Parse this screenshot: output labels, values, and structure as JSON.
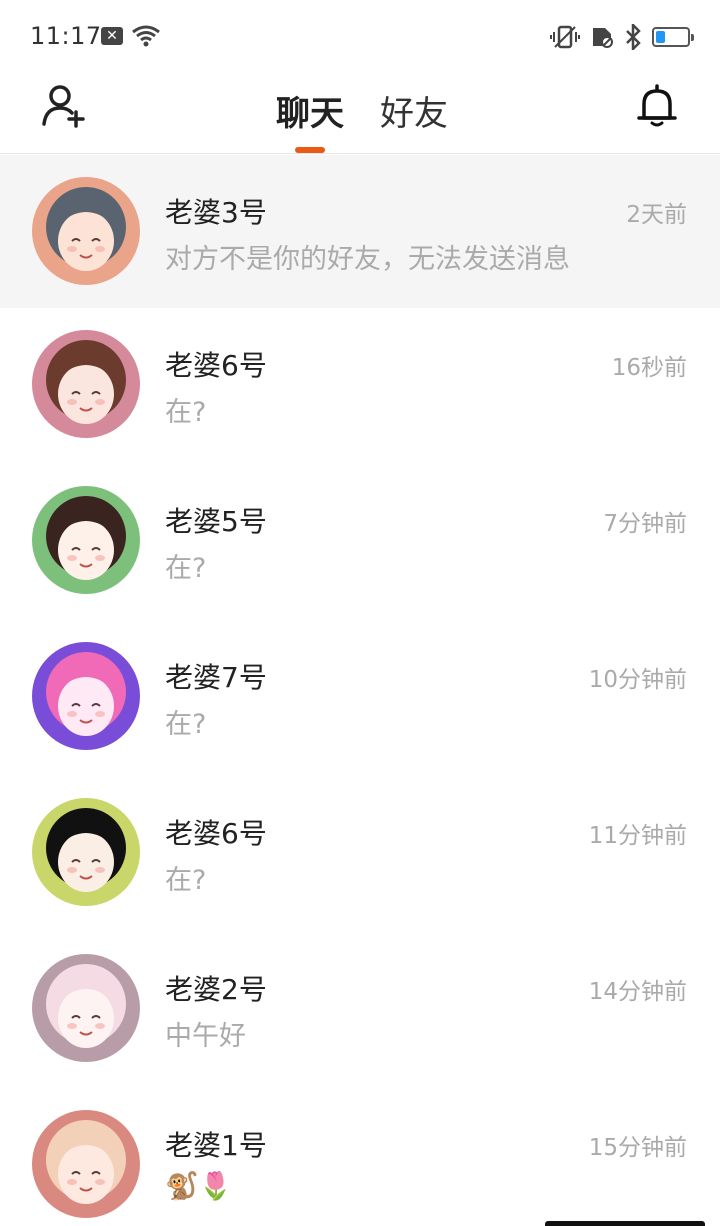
{
  "status_bar": {
    "time": "11:17",
    "notification_icon": "x-notification-icon",
    "battery_level_percent": 30,
    "accent_battery": "#2196f3"
  },
  "header": {
    "tabs": [
      {
        "label": "聊天",
        "active": true
      },
      {
        "label": "好友",
        "active": false
      }
    ],
    "accent": "#ea5a17"
  },
  "conversations": [
    {
      "name": "老婆3号",
      "preview": "对方不是你的好友，无法发送消息",
      "time": "2天前",
      "highlighted": true,
      "avatar_colors": [
        "#e9a48a",
        "#5a6470",
        "#fce3d6"
      ]
    },
    {
      "name": "老婆6号",
      "preview": "在?",
      "time": "16秒前",
      "highlighted": false,
      "avatar_colors": [
        "#d48a9a",
        "#6b3b2e",
        "#fbe6df"
      ]
    },
    {
      "name": "老婆5号",
      "preview": "在?",
      "time": "7分钟前",
      "highlighted": false,
      "avatar_colors": [
        "#7cc07c",
        "#3a2420",
        "#fdf1ea"
      ]
    },
    {
      "name": "老婆7号",
      "preview": "在?",
      "time": "10分钟前",
      "highlighted": false,
      "avatar_colors": [
        "#7a4dd8",
        "#f06ab8",
        "#ffe9f4"
      ]
    },
    {
      "name": "老婆6号",
      "preview": "在?",
      "time": "11分钟前",
      "highlighted": false,
      "avatar_colors": [
        "#c9d66a",
        "#111111",
        "#fbeee4"
      ]
    },
    {
      "name": "老婆2号",
      "preview": "中午好",
      "time": "14分钟前",
      "highlighted": false,
      "avatar_colors": [
        "#b89da8",
        "#f4dbe4",
        "#fdf3f3"
      ]
    },
    {
      "name": "老婆1号",
      "preview": "🐒🌷",
      "time": "15分钟前",
      "highlighted": false,
      "avatar_colors": [
        "#d98980",
        "#f3d0b8",
        "#fde9e0"
      ]
    }
  ]
}
